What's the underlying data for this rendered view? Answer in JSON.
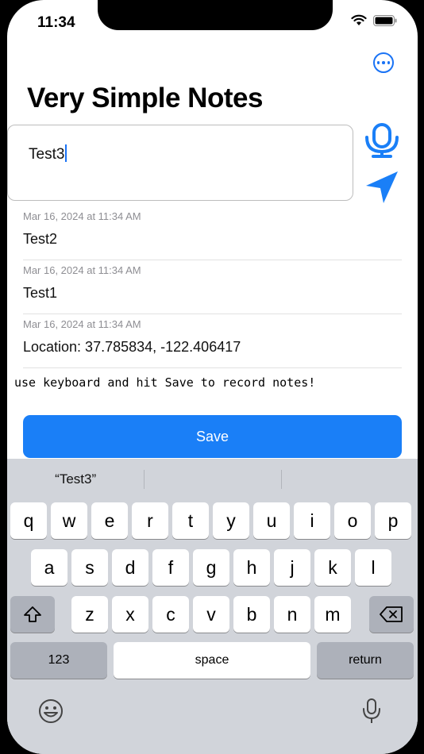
{
  "status": {
    "time": "11:34"
  },
  "header": {
    "title": "Very Simple Notes",
    "more_icon": "ellipsis-circle-icon"
  },
  "input": {
    "value": "Test3"
  },
  "actions": {
    "mic_icon": "microphone-icon",
    "location_icon": "location-arrow-icon"
  },
  "notes": [
    {
      "date": "Mar 16, 2024 at 11:34 AM",
      "text": "Test2"
    },
    {
      "date": "Mar 16, 2024 at 11:34 AM",
      "text": "Test1"
    },
    {
      "date": "Mar 16, 2024 at 11:34 AM",
      "text": "Location: 37.785834, -122.406417"
    }
  ],
  "hint": "use keyboard and hit Save to record notes!",
  "save_label": "Save",
  "keyboard": {
    "suggestions": [
      "“Test3”",
      "",
      ""
    ],
    "row1": [
      "q",
      "w",
      "e",
      "r",
      "t",
      "y",
      "u",
      "i",
      "o",
      "p"
    ],
    "row2": [
      "a",
      "s",
      "d",
      "f",
      "g",
      "h",
      "j",
      "k",
      "l"
    ],
    "row3": [
      "z",
      "x",
      "c",
      "v",
      "b",
      "n",
      "m"
    ],
    "numbers_label": "123",
    "space_label": "space",
    "return_label": "return"
  },
  "colors": {
    "accent": "#1a7ff7",
    "keyboard_bg": "#d1d4da"
  }
}
